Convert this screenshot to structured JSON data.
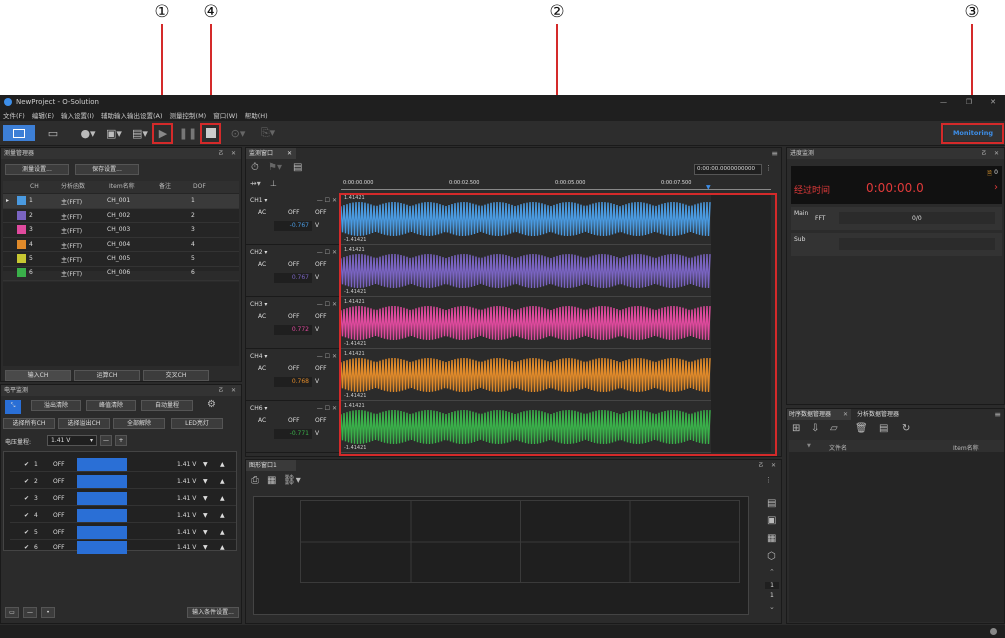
{
  "callouts": [
    "①",
    "④",
    "②",
    "③"
  ],
  "window_title": "NewProject - O-Solution",
  "menu": [
    "文件(F)",
    "编辑(E)",
    "输入设置(I)",
    "辅助输入输出设置(A)",
    "测量控制(M)",
    "窗口(W)",
    "帮助(H)"
  ],
  "toolbar": {
    "monitoring": "Monitoring"
  },
  "colors": {
    "accent": "#3d8ee8",
    "red": "#d42a2a",
    "ch1": "#4a9ae0",
    "ch2": "#7a64c2",
    "ch3": "#e04a9e",
    "ch4": "#e08a2a",
    "ch5": "#c8c832",
    "ch6": "#3ab04a"
  },
  "measure_manager": {
    "title": "测量管理器",
    "btn_measure": "测量设置...",
    "btn_save": "保存设置...",
    "columns": [
      "CH",
      "分析函数",
      "Item名称",
      "备注",
      "DOF"
    ],
    "rows": [
      {
        "ch": "1",
        "func": "主(FFT)",
        "item": "CH_001",
        "dof": "1"
      },
      {
        "ch": "2",
        "func": "主(FFT)",
        "item": "CH_002",
        "dof": "2"
      },
      {
        "ch": "3",
        "func": "主(FFT)",
        "item": "CH_003",
        "dof": "3"
      },
      {
        "ch": "4",
        "func": "主(FFT)",
        "item": "CH_004",
        "dof": "4"
      },
      {
        "ch": "5",
        "func": "主(FFT)",
        "item": "CH_005",
        "dof": "5"
      },
      {
        "ch": "6",
        "func": "主(FFT)",
        "item": "CH_006",
        "dof": "6"
      }
    ],
    "tabs": [
      "输入CH",
      "运算CH",
      "交叉CH"
    ]
  },
  "voltage_monitor": {
    "title": "电平监测",
    "btn_clear": "溢出清除",
    "btn_peak": "峰值清除",
    "btn_auto": "自动量程",
    "btn_all": "选择所有CH",
    "btn_overflow": "选择溢出CH",
    "btn_release": "全部解除",
    "btn_led": "LED亮灯",
    "range_label": "电压量程:",
    "range_value": "1.41 V",
    "rows": [
      {
        "n": "1",
        "off": "OFF",
        "v": "1.41 V"
      },
      {
        "n": "2",
        "off": "OFF",
        "v": "1.41 V"
      },
      {
        "n": "3",
        "off": "OFF",
        "v": "1.41 V"
      },
      {
        "n": "4",
        "off": "OFF",
        "v": "1.41 V"
      },
      {
        "n": "5",
        "off": "OFF",
        "v": "1.41 V"
      },
      {
        "n": "6",
        "off": "OFF",
        "v": "1.41 V"
      }
    ],
    "btn_input": "输入条件设置..."
  },
  "monitor_window": {
    "tab": "监测窗口",
    "time": "0:00:00.0000000000",
    "ticks": [
      "0:00:00.000",
      "0:00:02.500",
      "0:00:05.000",
      "0:00:07.500"
    ],
    "amp_label": "1.41421",
    "amp_label_neg": "-1.41421",
    "channels": [
      {
        "name": "CH1",
        "ac": "AC",
        "off1": "OFF",
        "off2": "OFF",
        "value": "-0.767",
        "unit": "V"
      },
      {
        "name": "CH2",
        "ac": "AC",
        "off1": "OFF",
        "off2": "OFF",
        "value": "0.767",
        "unit": "V"
      },
      {
        "name": "CH3",
        "ac": "AC",
        "off1": "OFF",
        "off2": "OFF",
        "value": "0.772",
        "unit": "V"
      },
      {
        "name": "CH4",
        "ac": "AC",
        "off1": "OFF",
        "off2": "OFF",
        "value": "0.768",
        "unit": "V"
      },
      {
        "name": "CH6",
        "ac": "AC",
        "off1": "OFF",
        "off2": "OFF",
        "value": "-0.771",
        "unit": "V"
      }
    ]
  },
  "graph_window": {
    "tab": "图形窗口1",
    "page": "1",
    "page2": "1"
  },
  "progress": {
    "title": "进度监测",
    "elapsed_label": "经过时间",
    "elapsed": "0:00:00.0",
    "count": "0",
    "main": "Main",
    "fft": "FFT",
    "frac": "0/0",
    "sub": "Sub"
  },
  "data_manager": {
    "tab1": "时序数据管理器",
    "tab2": "分析数据管理器",
    "col_file": "文件名",
    "col_item": "Item名称"
  }
}
